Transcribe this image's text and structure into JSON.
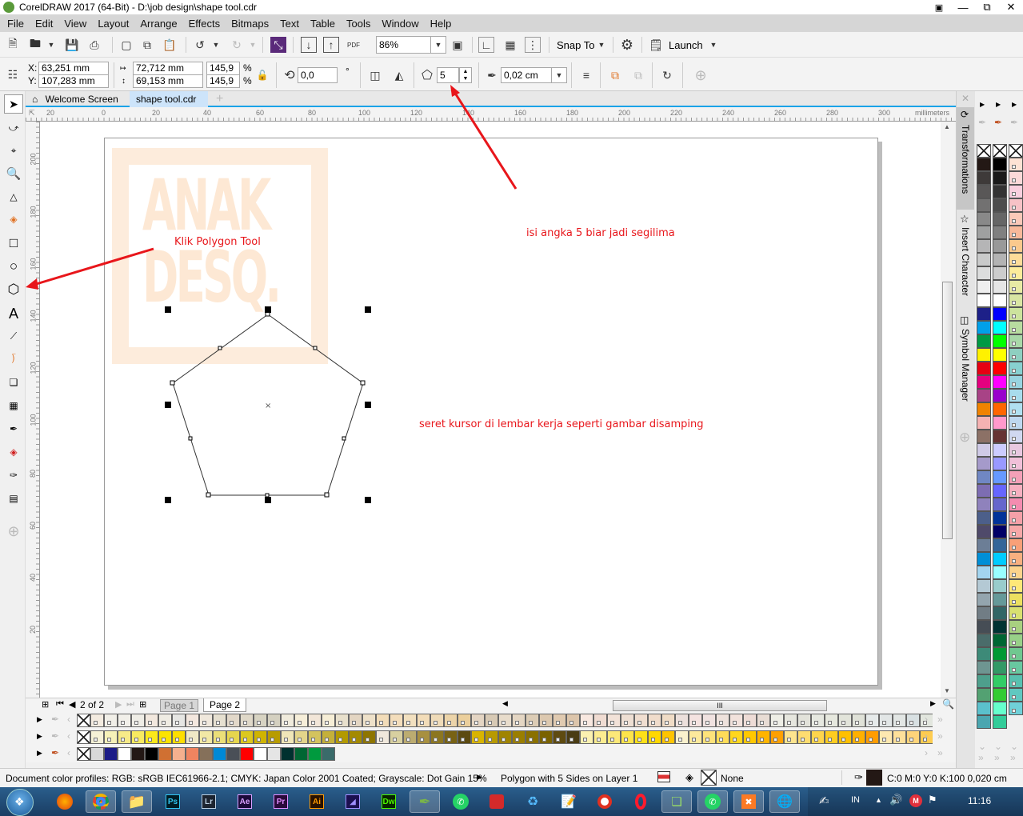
{
  "window": {
    "title": "CorelDRAW 2017 (64-Bit) - D:\\job design\\shape tool.cdr"
  },
  "menu": [
    "File",
    "Edit",
    "View",
    "Layout",
    "Arrange",
    "Effects",
    "Bitmaps",
    "Text",
    "Table",
    "Tools",
    "Window",
    "Help"
  ],
  "standard_toolbar": {
    "zoom_level": "86%",
    "snap_to_label": "Snap To",
    "launch_label": "Launch",
    "icons": [
      "new-document-icon",
      "open-icon",
      "save-icon",
      "print-icon",
      "cut-icon",
      "copy-icon",
      "paste-icon",
      "undo-icon",
      "redo-icon",
      "corel-connect-icon",
      "import-icon",
      "export-icon",
      "publish-pdf-icon",
      "full-screen-icon",
      "show-rulers-icon",
      "show-grid-icon",
      "show-guidelines-icon",
      "options-gear-icon",
      "launch-icon"
    ]
  },
  "property_bar": {
    "x_label": "X:",
    "x_value": "63,251 mm",
    "y_label": "Y:",
    "y_value": "107,283 mm",
    "width_value": "72,712 mm",
    "height_value": "69,153 mm",
    "scale_x": "145,9",
    "scale_y": "145,9",
    "percent": "%",
    "rotation": "0,0",
    "degree_symbol": "°",
    "polygon_sides": "5",
    "outline_width": "0,02 cm"
  },
  "doc_tabs": [
    {
      "label": "Welcome Screen",
      "active": false
    },
    {
      "label": "shape tool.cdr",
      "active": true
    }
  ],
  "ruler": {
    "units": "millimeters",
    "h_ticks": [
      "20",
      "0",
      "20",
      "40",
      "60",
      "80",
      "100",
      "120",
      "140",
      "160",
      "180",
      "200",
      "220",
      "240",
      "260",
      "280",
      "300"
    ],
    "v_ticks": [
      "200",
      "180",
      "160",
      "140",
      "120",
      "100",
      "80",
      "60",
      "40",
      "20"
    ]
  },
  "watermark": {
    "line1": "ANAK",
    "line2": "DESQ."
  },
  "annotations": {
    "polygon_tool": "Klik Polygon Tool",
    "sides": "isi angka 5 biar jadi segilima",
    "drag": "seret kursor di lembar kerja seperti gambar disamping"
  },
  "toolbox": [
    "pick-tool",
    "shape-tool",
    "crop-tool",
    "zoom-tool",
    "freehand-tool",
    "smart-fill-tool",
    "rectangle-tool",
    "ellipse-tool",
    "polygon-tool",
    "text-tool",
    "parallel-dimension-tool",
    "connector-tool",
    "drop-shadow-tool",
    "transparency-tool",
    "color-eyedropper-tool",
    "interactive-fill-tool",
    "outline-pen-tool",
    "smart-fill-2-tool",
    "add-tool"
  ],
  "page_nav": {
    "current": "2",
    "of_label": "of",
    "total": "2",
    "pages": [
      "Page 1",
      "Page 2"
    ],
    "active_page": "Page 2"
  },
  "dockers": [
    "Transformations",
    "Insert Character",
    "Symbol Manager"
  ],
  "palettes": {
    "row1": [
      "#f3ebe0",
      "#f1efe8",
      "#f2f0ea",
      "#efede6",
      "#f2e8de",
      "#efece3",
      "#e6e6e3",
      "#f3e7de",
      "#f0e8dc",
      "#e6e0d0",
      "#e2d8c9",
      "#dfd8c8",
      "#d7d3c2",
      "#d4d0c0",
      "#f0ebdc",
      "#f6eed9",
      "#f2e6d8",
      "#f6eed6",
      "#e8e0cc",
      "#e3d5c2",
      "#eee1c9",
      "#f2dcb8",
      "#f3ddbb",
      "#f2e0bf",
      "#f2dcb8",
      "#efdbb8",
      "#ecd4a9",
      "#ebcf9c",
      "#e4d5c3",
      "#d7c9b4",
      "#e8dccb",
      "#e4d6c3",
      "#dcccb5",
      "#dcc8af",
      "#e0cab0",
      "#dcc5ab",
      "#f8e8e0",
      "#f0dcd2",
      "#f2e2d8",
      "#eedfd3",
      "#f0ded0",
      "#f0dccb",
      "#f0dcc6",
      "#ece0dc",
      "#f4e2e0",
      "#f0e2e0",
      "#eee2dc",
      "#f2e2dc",
      "#eedcd6",
      "#e8dcd4",
      "#eeeee6",
      "#e6e6de",
      "#e2e2da",
      "#e6e8e0",
      "#e6e8de",
      "#e2e4da",
      "#e0e2d8",
      "#e6eaea",
      "#e2e6e6",
      "#e2e6e4",
      "#d8e0e2",
      "#e2e6de"
    ],
    "row2": [
      "#f5f1d6",
      "#f6f1b8",
      "#f7ea88",
      "#f8ea60",
      "#fbe81a",
      "#fce400",
      "#fede00",
      "#f0e9c6",
      "#f2e8a5",
      "#ebdf78",
      "#e6d64e",
      "#dcc81e",
      "#cfb400",
      "#b89c00",
      "#f0e6b8",
      "#e3d48a",
      "#d4c35e",
      "#c4b03a",
      "#b39a00",
      "#a48a00",
      "#8e7500",
      "#f0e8dc",
      "#d8d0a0",
      "#bcac70",
      "#a89040",
      "#8c7620",
      "#786214",
      "#5c4a10",
      "#d8b400",
      "#b89a00",
      "#a08400",
      "#9a7e00",
      "#8a7000",
      "#7a6200",
      "#5e4a10",
      "#4a3c14",
      "#fbf1b0",
      "#fcec90",
      "#fce878",
      "#fde44a",
      "#fee018",
      "#ffd800",
      "#ffc400",
      "#faf1cd",
      "#fde99c",
      "#fde27a",
      "#fedc58",
      "#ffd61e",
      "#ffc800",
      "#ffb400",
      "#ffa000",
      "#fde48e",
      "#fedc70",
      "#fed44c",
      "#fecc20",
      "#ffc000",
      "#ffb000",
      "#ff9c00",
      "#fde8b0",
      "#fee09a",
      "#fed47a",
      "#fecc50",
      "#ffc020"
    ],
    "row3": [
      "#d9d9d9",
      "#1c1c87",
      "#ffffff",
      "#231815",
      "#000000",
      "#d07032",
      "#f5b08e",
      "#ef8460",
      "#85705a",
      "#0089d6",
      "#4a4f57",
      "#ff0000",
      "#ffffff",
      "#e5e5e5",
      "#00312f",
      "#006633",
      "#009a3e",
      "#3a6b6a"
    ],
    "v1": [
      "#231815",
      "#3e3a39",
      "#595757",
      "#727171",
      "#898989",
      "#9fa0a0",
      "#b5b5b6",
      "#c9caca",
      "#dcdddd",
      "#efefef",
      "#ffffff",
      "#1d2088",
      "#00a0e9",
      "#009944",
      "#fff100",
      "#e60012",
      "#e4007f",
      "#a84386",
      "#f08300",
      "#f5b2b2",
      "#8c7166",
      "#cfcae6",
      "#a59aca",
      "#7087c3",
      "#7d6db2",
      "#8f82bc",
      "#4c5f8a",
      "#4f4a6a",
      "#6c7e96",
      "#008fd7",
      "#a3d5f0",
      "#b4c9d4",
      "#94a5ae",
      "#717d85",
      "#464d55",
      "#4a6c6a",
      "#3d8a78",
      "#6e9591",
      "#4e9f8c",
      "#53a172",
      "#5bc0cc",
      "#4ba6b0"
    ],
    "v2": [
      "#000000",
      "#1a1a1a",
      "#333333",
      "#4d4d4d",
      "#666666",
      "#808080",
      "#999999",
      "#b3b3b3",
      "#cccccc",
      "#e6e6e6",
      "#ffffff",
      "#0000ff",
      "#00ffff",
      "#00ff00",
      "#ffff00",
      "#ff0000",
      "#ff00ff",
      "#9900cc",
      "#ff6600",
      "#ff99cc",
      "#663333",
      "#ccccff",
      "#9999ff",
      "#6699ff",
      "#6666ff",
      "#6666cc",
      "#003399",
      "#000066",
      "#336699",
      "#00ccff",
      "#99ffff",
      "#99cccc",
      "#669999",
      "#336666",
      "#003333",
      "#006633",
      "#009933",
      "#339966",
      "#33cc66",
      "#33cc33",
      "#66ffcc",
      "#33cc99"
    ],
    "v3": [
      "#fde2d4",
      "#fbd9d8",
      "#f9d0de",
      "#f7c2c6",
      "#fac9b9",
      "#f8b99a",
      "#fbc98d",
      "#fedc99",
      "#fdec9b",
      "#e8eaa4",
      "#d9e5a3",
      "#cce39d",
      "#b8dca0",
      "#a8d8a8",
      "#8ecfc0",
      "#88d0d0",
      "#98d4e0",
      "#a8dcec",
      "#b0e0f0",
      "#bed8f0",
      "#d0d8f0",
      "#e8c8e0",
      "#f0c0d8",
      "#f4a0b8",
      "#f6b0c0",
      "#f48cb0",
      "#f4a0a8",
      "#f6a8a8",
      "#f8a078",
      "#f8b080",
      "#fcd48c",
      "#fee878",
      "#ece060",
      "#d8e070",
      "#a8d080",
      "#98d088",
      "#70c890",
      "#68c8a0",
      "#58c0b0",
      "#60c8c0",
      "#70d0d8"
    ]
  },
  "status": {
    "color_profiles": "Document color profiles: RGB: sRGB IEC61966-2.1; CMYK: Japan Color 2001 Coated; Grayscale: Dot Gain 15%",
    "object_info": "Polygon with 5 Sides on Layer 1",
    "fill_label": "None",
    "outline_info": "C:0 M:0 Y:0 K:100  0,020 cm",
    "outline_color": "#231815"
  },
  "taskbar": {
    "apps": [
      "Firefox",
      "Chrome",
      "Explorer",
      "Ps",
      "Lr",
      "Ae",
      "Pr",
      "Ai",
      "Premiere Encoder",
      "Dw",
      "CorelDRAW",
      "WhatsApp",
      "SketchUp",
      "Recycle",
      "Notepad",
      "Recorder",
      "Opera",
      "Messenger",
      "WhatsApp",
      "XAMPP",
      "IDM"
    ],
    "language": "IN",
    "time": "11:16"
  }
}
